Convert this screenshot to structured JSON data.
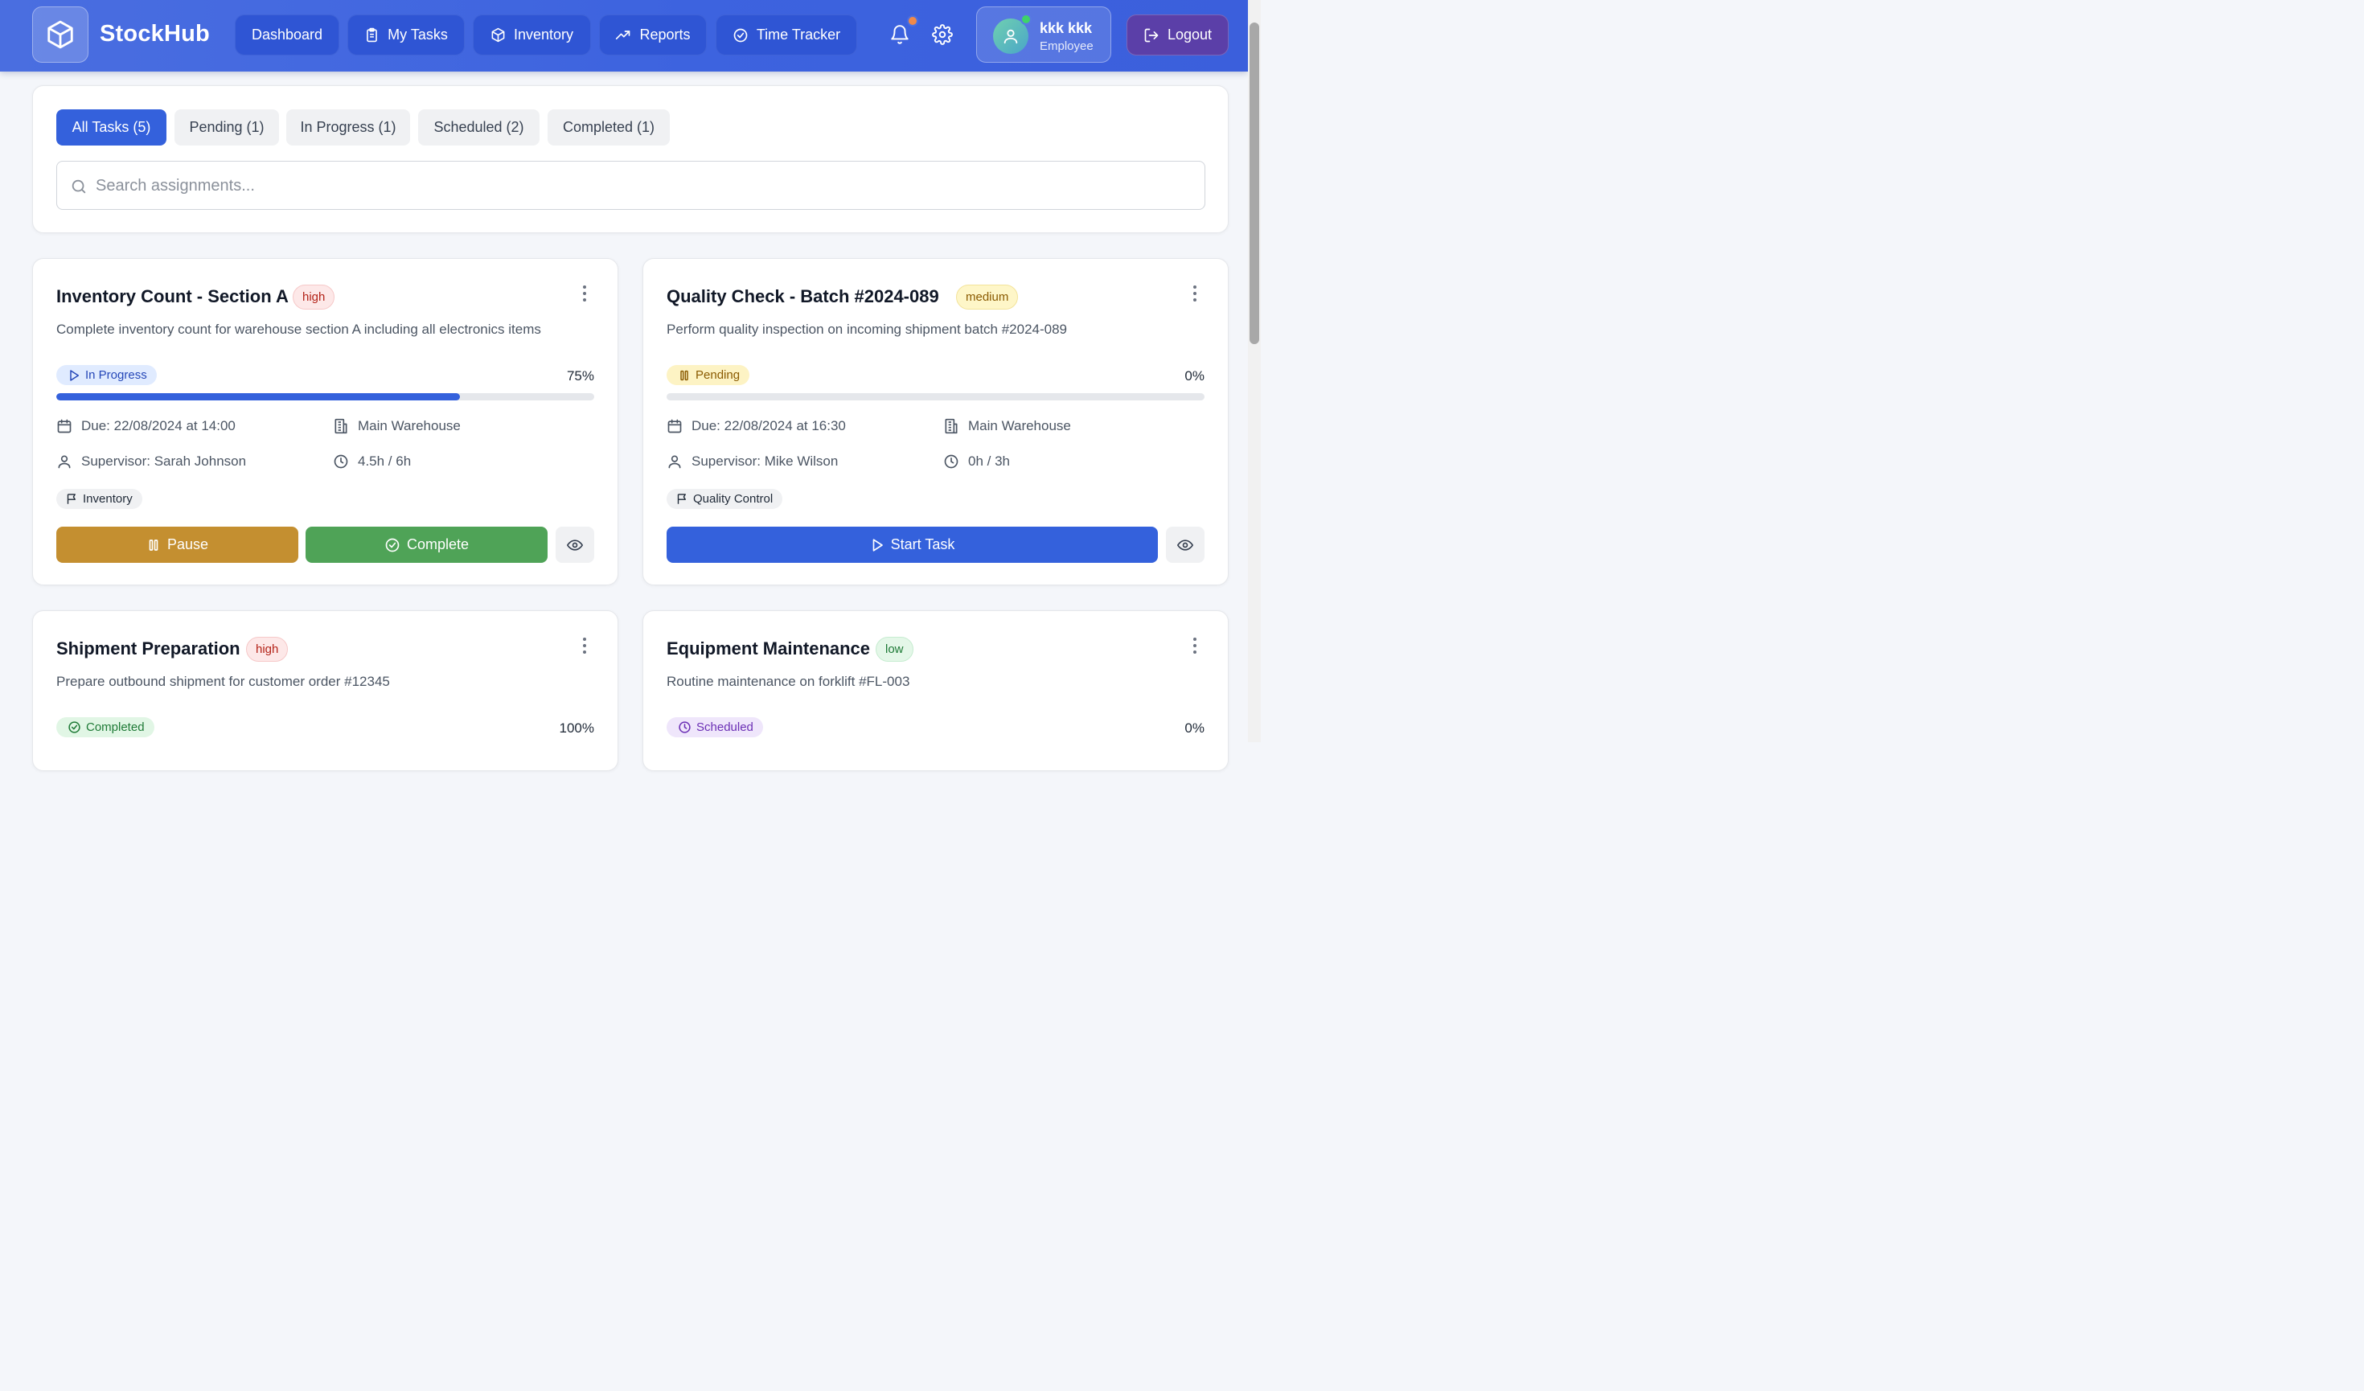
{
  "header": {
    "brand": "StockHub",
    "nav": [
      {
        "label": "Dashboard",
        "icon": "none"
      },
      {
        "label": "My Tasks",
        "icon": "clipboard-icon"
      },
      {
        "label": "Inventory",
        "icon": "package-icon"
      },
      {
        "label": "Reports",
        "icon": "trending-up-icon"
      },
      {
        "label": "Time Tracker",
        "icon": "check-circle-icon"
      }
    ],
    "user": {
      "name": "kkk kkk",
      "role": "Employee"
    },
    "logout_label": "Logout",
    "colors": {
      "bar": "#3d63df",
      "nav_button": "#2f55d4",
      "logout": "#5b3fa8"
    }
  },
  "filters": {
    "tabs": [
      {
        "label": "All Tasks (5)",
        "active": true
      },
      {
        "label": "Pending (1)",
        "active": false
      },
      {
        "label": "In Progress (1)",
        "active": false
      },
      {
        "label": "Scheduled (2)",
        "active": false
      },
      {
        "label": "Completed (1)",
        "active": false
      }
    ],
    "search_placeholder": "Search assignments...",
    "search_value": ""
  },
  "tasks": [
    {
      "title": "Inventory Count - Section A",
      "priority": "high",
      "description": "Complete inventory count for warehouse section A including all electronics items",
      "status": "In Progress",
      "progress_label": "75%",
      "progress": 0.75,
      "due": "Due: 22/08/2024 at 14:00",
      "location": "Main Warehouse",
      "supervisor": "Supervisor: Sarah Johnson",
      "hours": "4.5h / 6h",
      "category": "Inventory",
      "actions": {
        "pause": "Pause",
        "complete": "Complete"
      }
    },
    {
      "title": "Quality Check - Batch #2024-089",
      "priority": "medium",
      "description": "Perform quality inspection on incoming shipment batch #2024-089",
      "status": "Pending",
      "progress_label": "0%",
      "progress": 0,
      "due": "Due: 22/08/2024 at 16:30",
      "location": "Main Warehouse",
      "supervisor": "Supervisor: Mike Wilson",
      "hours": "0h / 3h",
      "category": "Quality Control",
      "actions": {
        "start": "Start Task"
      }
    },
    {
      "title": "Shipment Preparation",
      "priority": "high",
      "description": "Prepare outbound shipment for customer order #12345",
      "status": "Completed",
      "progress_label": "100%",
      "progress": 1
    },
    {
      "title": "Equipment Maintenance",
      "priority": "low",
      "description": "Routine maintenance on forklift #FL-003",
      "status": "Scheduled",
      "progress_label": "0%",
      "progress": 0
    }
  ]
}
